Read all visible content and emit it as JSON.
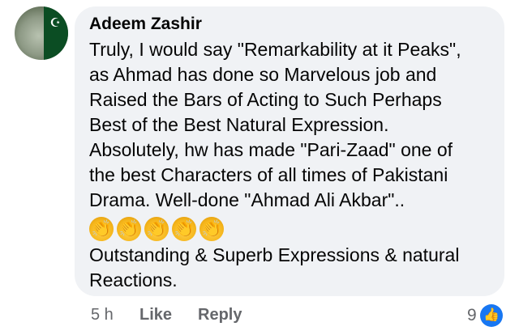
{
  "comment": {
    "author": "Adeem Zashir",
    "lines": [
      "Truly, I would say \"Remarkability at it Peaks\",",
      "as Ahmad has done so Marvelous job and",
      "Raised the Bars of Acting to Such Perhaps",
      "Best of the Best Natural Expression.",
      "Absolutely, hw has  made \"Pari-Zaad\" one of",
      "the best Characters of all times of Pakistani",
      "Drama. Well-done \"Ahmad Ali Akbar\".."
    ],
    "emoji": [
      "clapping-hands",
      "clapping-hands",
      "clapping-hands",
      "clapping-hands",
      "clapping-hands"
    ],
    "lines2": [
      "Outstanding & Superb Expressions & natural",
      "Reactions."
    ]
  },
  "actions": {
    "time": "5 h",
    "like": "Like",
    "reply": "Reply"
  },
  "reactions": {
    "count": "9",
    "icon": "thumbs-up-icon",
    "color": "#1877f2"
  }
}
